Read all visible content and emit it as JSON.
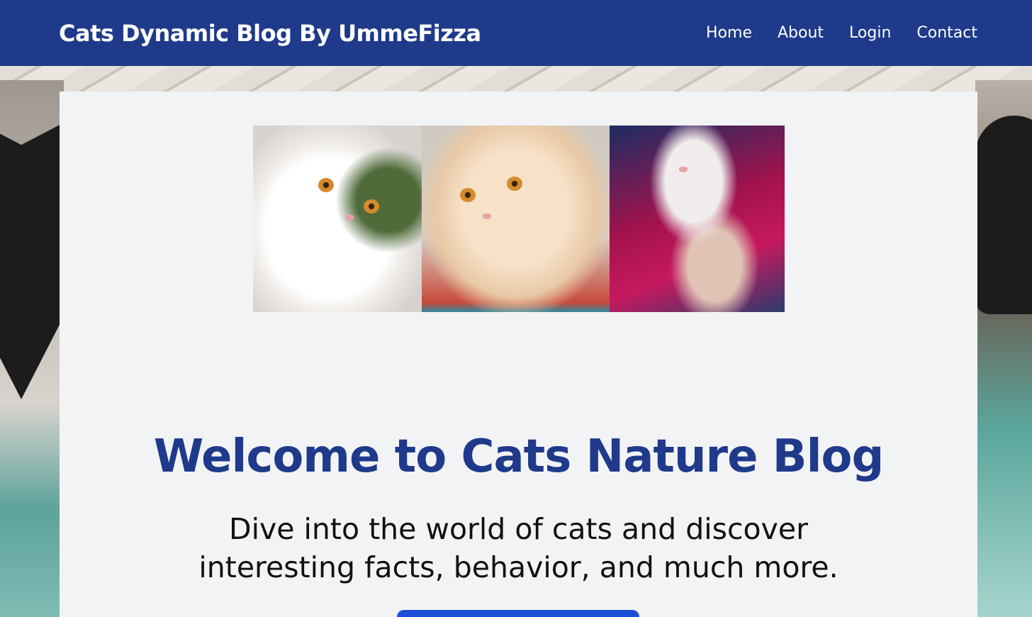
{
  "colors": {
    "navbar_bg": "#1f3a8a",
    "accent": "#1f3a8a",
    "card_bg": "#f2f3f5",
    "button_bg": "#1d4ed8"
  },
  "header": {
    "brand": "Cats Dynamic Blog By UmmeFizza",
    "nav": [
      {
        "label": "Home"
      },
      {
        "label": "About"
      },
      {
        "label": "Login"
      },
      {
        "label": "Contact"
      }
    ]
  },
  "hero": {
    "gallery": [
      {
        "icon": "white-persian-cat-photo"
      },
      {
        "icon": "cream-persian-cat-photo"
      },
      {
        "icon": "cat-in-red-blanket-photo"
      }
    ],
    "title": "Welcome to Cats Nature Blog",
    "subtitle": "Dive into the world of cats and discover interesting facts, behavior, and much more.",
    "cta_label": ""
  }
}
